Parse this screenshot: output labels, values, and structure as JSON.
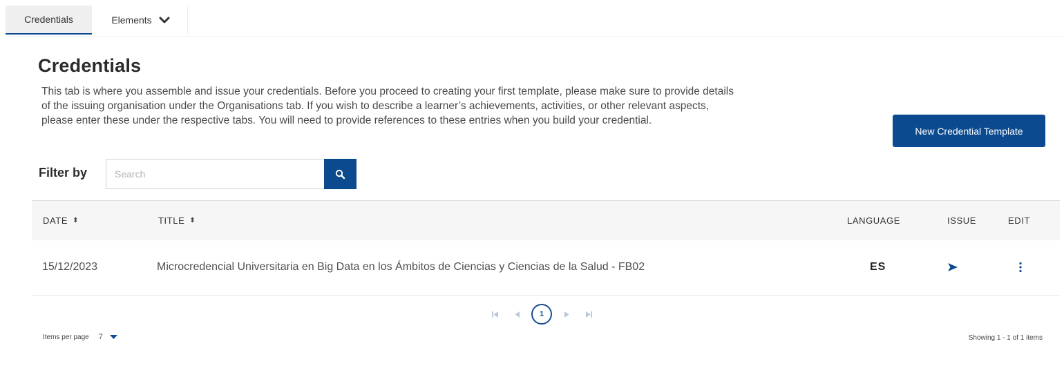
{
  "tabs": [
    {
      "label": "Credentials",
      "active": true
    },
    {
      "label": "Elements",
      "active": false
    }
  ],
  "page": {
    "title": "Credentials",
    "intro": "This tab is where you assemble and issue your credentials. Before you proceed to creating your first template, please make sure to provide details of the issuing organisation under the Organisations tab. If you wish to describe a learner’s achievements, activities, or other relevant aspects, please enter these under the respective tabs. You will need to provide references to these entries when you build your credential."
  },
  "actions": {
    "new_template_label": "New Credential Template"
  },
  "filter": {
    "label": "Filter by",
    "placeholder": "Search",
    "value": ""
  },
  "table": {
    "headers": {
      "date": "DATE",
      "title": "TITLE",
      "language": "LANGUAGE",
      "issue": "ISSUE",
      "edit": "EDIT"
    },
    "sort_glyph": "⬍",
    "rows": [
      {
        "date": "15/12/2023",
        "title": "Microcredencial Universitaria en Big Data en los Ámbitos de Ciencias y Ciencias de la Salud - FB02",
        "language": "ES"
      }
    ]
  },
  "pagination": {
    "current_page": "1"
  },
  "footer": {
    "items_per_page_label": "Items per page",
    "items_per_page_value": "7",
    "showing": "Showing 1 - 1 of 1 items"
  },
  "icons": {
    "elements_dropdown": "chevron-down-icon",
    "search": "search-icon",
    "sort": "sort-icon",
    "issue": "send-icon",
    "edit": "kebab-menu-icon",
    "first": "first-page-icon",
    "prev": "prev-page-icon",
    "next": "next-page-icon",
    "last": "last-page-icon"
  },
  "colors": {
    "primary": "#0b4a8f",
    "pager_inactive": "#b9c8dc",
    "header_bg": "#f6f6f6"
  }
}
